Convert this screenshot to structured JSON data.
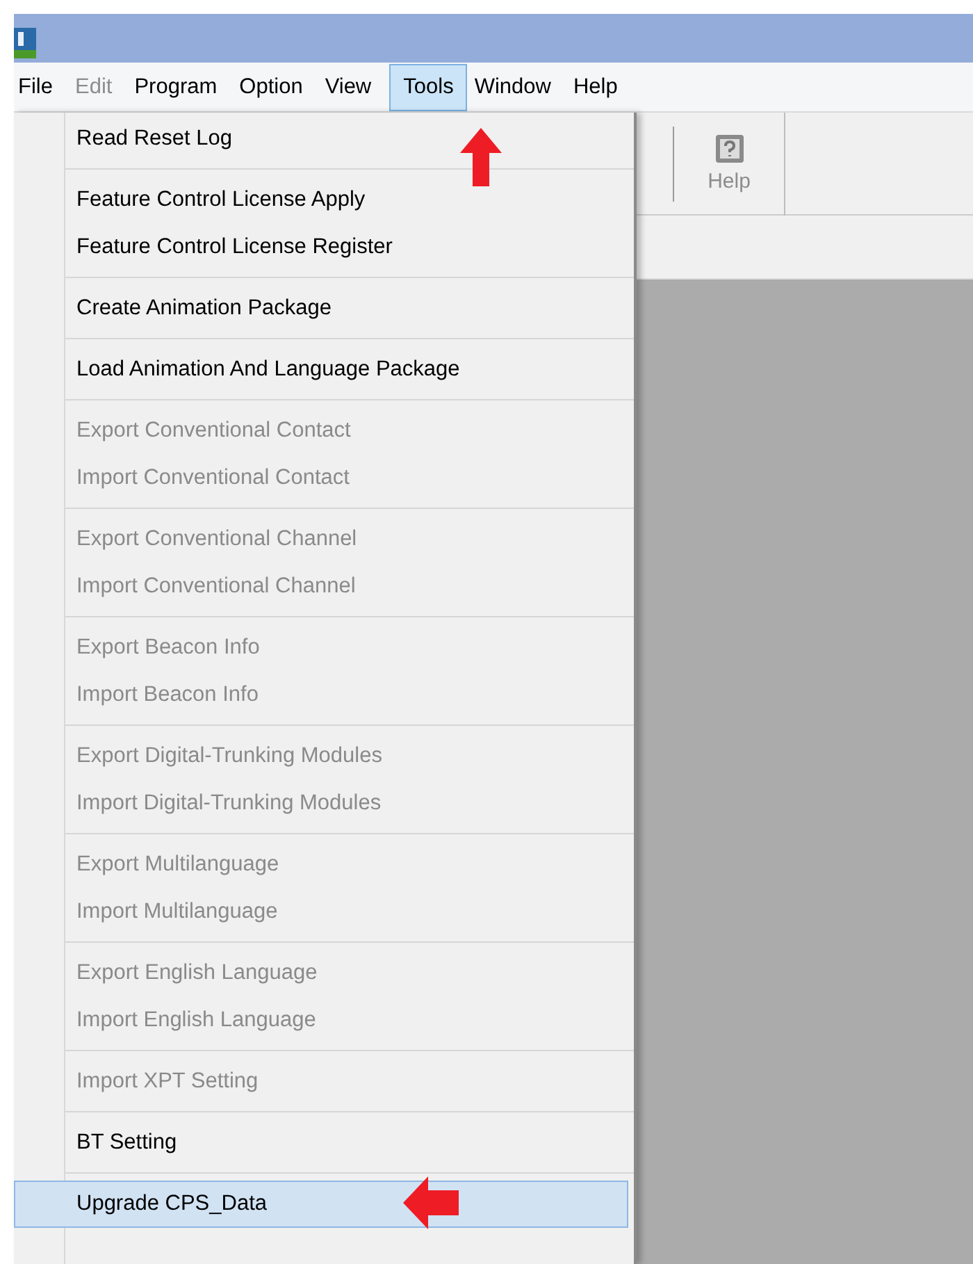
{
  "menu_bar": [
    {
      "label": "File",
      "disabled": false,
      "selected": false
    },
    {
      "label": "Edit",
      "disabled": true,
      "selected": false
    },
    {
      "label": "Program",
      "disabled": false,
      "selected": false
    },
    {
      "label": "Option",
      "disabled": false,
      "selected": false
    },
    {
      "label": "View",
      "disabled": false,
      "selected": false
    },
    {
      "label": "Tools",
      "disabled": false,
      "selected": true
    },
    {
      "label": "Window",
      "disabled": false,
      "selected": false
    },
    {
      "label": "Help",
      "disabled": false,
      "selected": false
    }
  ],
  "toolbar": {
    "help_button": {
      "label": "Help",
      "disabled": true
    }
  },
  "tools_menu": [
    [
      {
        "label": "Read Reset Log",
        "disabled": false,
        "selected": false
      }
    ],
    [
      {
        "label": "Feature Control License Apply",
        "disabled": false,
        "selected": false
      },
      {
        "label": "Feature Control License Register",
        "disabled": false,
        "selected": false
      }
    ],
    [
      {
        "label": "Create Animation Package",
        "disabled": false,
        "selected": false
      }
    ],
    [
      {
        "label": "Load Animation And Language Package",
        "disabled": false,
        "selected": false
      }
    ],
    [
      {
        "label": "Export Conventional Contact",
        "disabled": true,
        "selected": false
      },
      {
        "label": "Import Conventional Contact",
        "disabled": true,
        "selected": false
      }
    ],
    [
      {
        "label": "Export Conventional Channel",
        "disabled": true,
        "selected": false
      },
      {
        "label": "Import Conventional Channel",
        "disabled": true,
        "selected": false
      }
    ],
    [
      {
        "label": "Export Beacon Info",
        "disabled": true,
        "selected": false
      },
      {
        "label": "Import Beacon Info",
        "disabled": true,
        "selected": false
      }
    ],
    [
      {
        "label": "Export Digital-Trunking Modules",
        "disabled": true,
        "selected": false
      },
      {
        "label": "Import Digital-Trunking Modules",
        "disabled": true,
        "selected": false
      }
    ],
    [
      {
        "label": "Export Multilanguage",
        "disabled": true,
        "selected": false
      },
      {
        "label": "Import Multilanguage",
        "disabled": true,
        "selected": false
      }
    ],
    [
      {
        "label": "Export English Language",
        "disabled": true,
        "selected": false
      },
      {
        "label": "Import English Language",
        "disabled": true,
        "selected": false
      }
    ],
    [
      {
        "label": "Import XPT Setting",
        "disabled": true,
        "selected": false
      }
    ],
    [
      {
        "label": "BT Setting",
        "disabled": false,
        "selected": false
      }
    ],
    [
      {
        "label": "Upgrade CPS_Data",
        "disabled": false,
        "selected": true
      }
    ]
  ]
}
